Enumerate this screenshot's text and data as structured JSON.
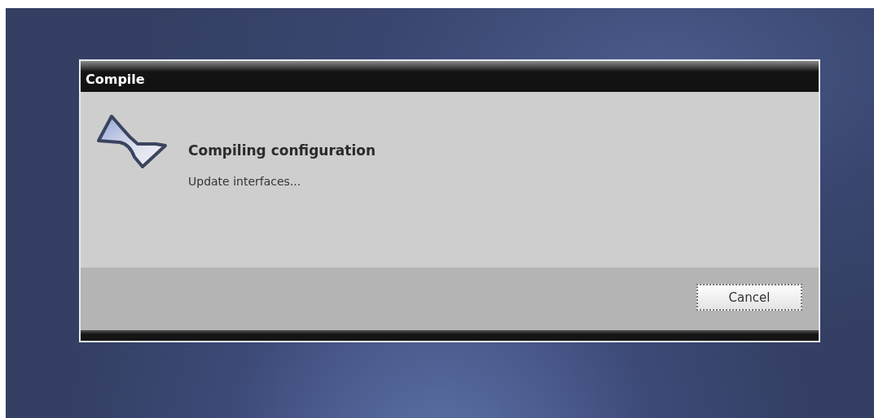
{
  "dialog": {
    "title": "Compile",
    "heading": "Compiling configuration",
    "status": "Update interfaces...",
    "buttons": [
      {
        "label": "Cancel"
      }
    ]
  }
}
